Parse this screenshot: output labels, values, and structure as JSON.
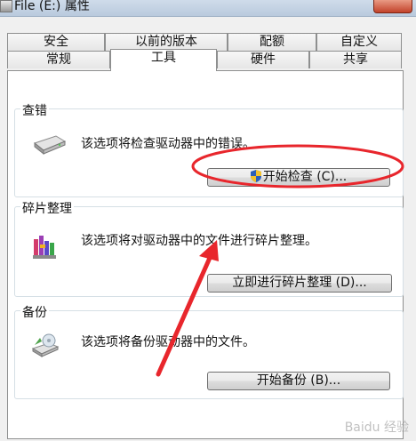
{
  "window": {
    "title": "File (E:) 属性"
  },
  "tabs": {
    "back": [
      "安全",
      "以前的版本",
      "配额",
      "自定义"
    ],
    "front": [
      "常规",
      "工具",
      "硬件",
      "共享"
    ],
    "active": "工具"
  },
  "error_check": {
    "legend": "查错",
    "description": "该选项将检查驱动器中的错误。",
    "button": "开始检查 (C)..."
  },
  "defrag": {
    "legend": "碎片整理",
    "description": "该选项将对驱动器中的文件进行碎片整理。",
    "button": "立即进行碎片整理 (D)..."
  },
  "backup": {
    "legend": "备份",
    "description": "该选项将备份驱动器中的文件。",
    "button": "开始备份 (B)..."
  },
  "watermark": "Baidu 经验",
  "colors": {
    "annotation_red": "#e8262c",
    "dialog_bg": "#f0f0f0",
    "border": "#8e8f8f"
  }
}
